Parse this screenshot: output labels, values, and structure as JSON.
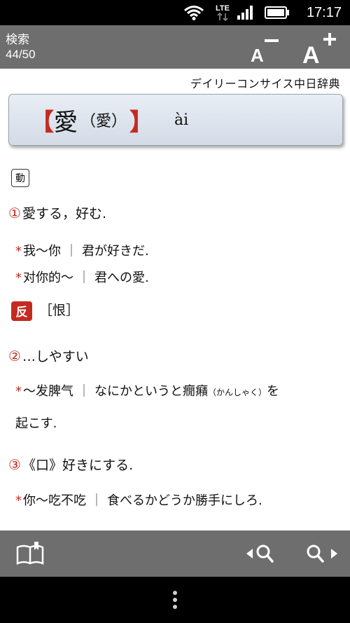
{
  "status_bar": {
    "time": "17:17",
    "network": "LTE",
    "icons": [
      "wifi-icon",
      "lte-icon",
      "signal-icon",
      "battery-icon"
    ]
  },
  "header": {
    "title": "検索",
    "result_count": "44/50",
    "font_smaller_label": "A",
    "font_larger_label": "A"
  },
  "dictionary_name": "デイリーコンサイス中日辞典",
  "entry": {
    "bracket_open": "【",
    "headword": "愛",
    "traditional": "（愛）",
    "bracket_close": "】",
    "pinyin": "ài",
    "part_of_speech": "動",
    "senses": [
      {
        "number": "①",
        "definition": "愛する，好む.",
        "examples": [
          {
            "star": "*",
            "cn": "我～你",
            "jp": "君が好きだ."
          },
          {
            "star": "*",
            "cn": "对你的～",
            "jp": "君への愛."
          }
        ]
      },
      {
        "number": "②",
        "definition": "…しやすい",
        "examples": [
          {
            "star": "*",
            "cn": "～发脾气",
            "jp": "なにかというと癇癪",
            "reading": "（かんしゃく）",
            "jp_tail": "を",
            "jp_cont": "起こす."
          }
        ]
      },
      {
        "number": "③",
        "definition": "《口》好きにする.",
        "examples": [
          {
            "star": "*",
            "cn": "你～吃不吃",
            "jp": "食べるかどうか勝手にしろ."
          }
        ]
      }
    ],
    "antonym_label": "反",
    "antonym": "［恨］"
  },
  "separator": "｜",
  "colors": {
    "accent_red": "#c42a20",
    "bar_gray": "#6e6e6e",
    "headword_box": "#dfe5ee"
  },
  "toolbar_icons": [
    "book-icon",
    "search-prev-icon",
    "search-next-icon"
  ],
  "navbar_icons": [
    "menu-dots-icon"
  ]
}
